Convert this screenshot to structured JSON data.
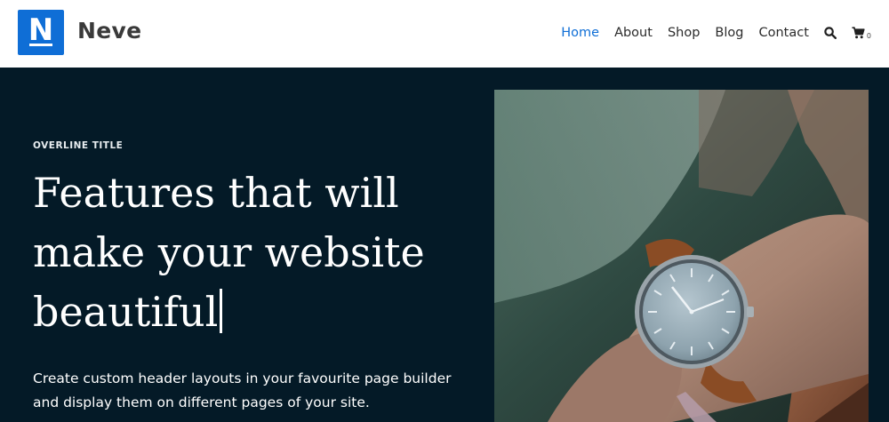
{
  "brand": {
    "logo_letter": "N",
    "title": "Neve",
    "accent_color": "#0f6ed6"
  },
  "nav": {
    "items": [
      {
        "label": "Home",
        "active": true
      },
      {
        "label": "About",
        "active": false
      },
      {
        "label": "Shop",
        "active": false
      },
      {
        "label": "Blog",
        "active": false
      },
      {
        "label": "Contact",
        "active": false
      }
    ],
    "search_icon": "search-icon",
    "cart_icon": "cart-icon",
    "cart_count": "0"
  },
  "hero": {
    "overline": "OVERLINE TITLE",
    "headline_line1": "Features that will",
    "headline_line2": "make your website",
    "headline_line3": "beautiful",
    "subtext_line1": "Create custom header layouts in your favourite page builder",
    "subtext_line2": "and display them on different pages of your site.",
    "background_color": "#041a27",
    "image": "wristwatch-photo"
  }
}
